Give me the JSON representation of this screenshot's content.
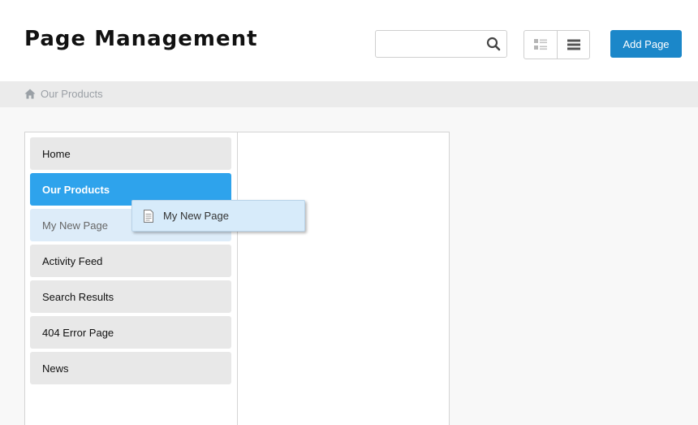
{
  "header": {
    "title": "Page Management",
    "search": {
      "value": "",
      "placeholder": "",
      "icon": "search-icon"
    },
    "view_toggle": {
      "options": [
        "tree-view-icon",
        "list-view-icon"
      ]
    },
    "add_button_label": "Add Page",
    "accent_color": "#1b87c9"
  },
  "breadcrumb": {
    "home_icon": "home-icon",
    "current": "Our Products"
  },
  "pages": [
    {
      "label": "Home"
    },
    {
      "label": "Our Products",
      "state": "selected"
    },
    {
      "label": "My New Page",
      "state": "drop-placeholder"
    },
    {
      "label": "Activity Feed"
    },
    {
      "label": "Search Results"
    },
    {
      "label": "404 Error Page"
    },
    {
      "label": "News"
    }
  ],
  "drag_item": {
    "label": "My New Page",
    "icon": "document-icon"
  },
  "colors": {
    "selected_item": "#2ea3ec",
    "placeholder_item": "#ddecf9",
    "item_background": "#e8e8e8",
    "breadcrumb_bar": "#ebebeb"
  }
}
